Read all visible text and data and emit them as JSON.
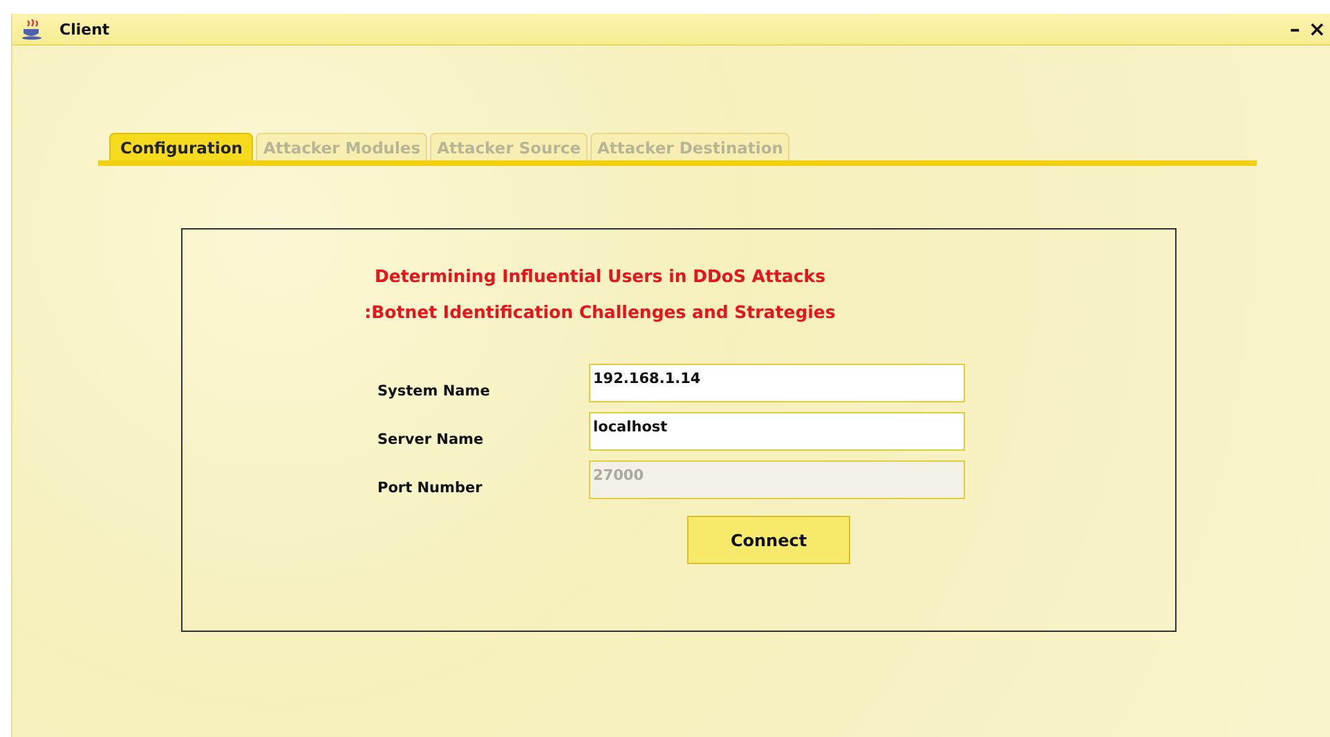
{
  "window": {
    "title": "Client",
    "minimize": "–",
    "close": "×"
  },
  "tabs": [
    {
      "label": "Configuration",
      "selected": true
    },
    {
      "label": "Attacker Modules",
      "selected": false
    },
    {
      "label": "Attacker Source",
      "selected": false
    },
    {
      "label": "Attacker Destination",
      "selected": false
    }
  ],
  "heading": [
    "Determining Influential Users in DDoS Attacks",
    ":Botnet Identification Challenges and Strategies"
  ],
  "fields": [
    {
      "label": "System Name",
      "value": "192.168.1.14",
      "disabled": false
    },
    {
      "label": "Server Name",
      "value": "localhost",
      "disabled": false
    },
    {
      "label": "Port Number",
      "value": "27000",
      "disabled": true
    }
  ],
  "buttons": [
    "Connect"
  ]
}
